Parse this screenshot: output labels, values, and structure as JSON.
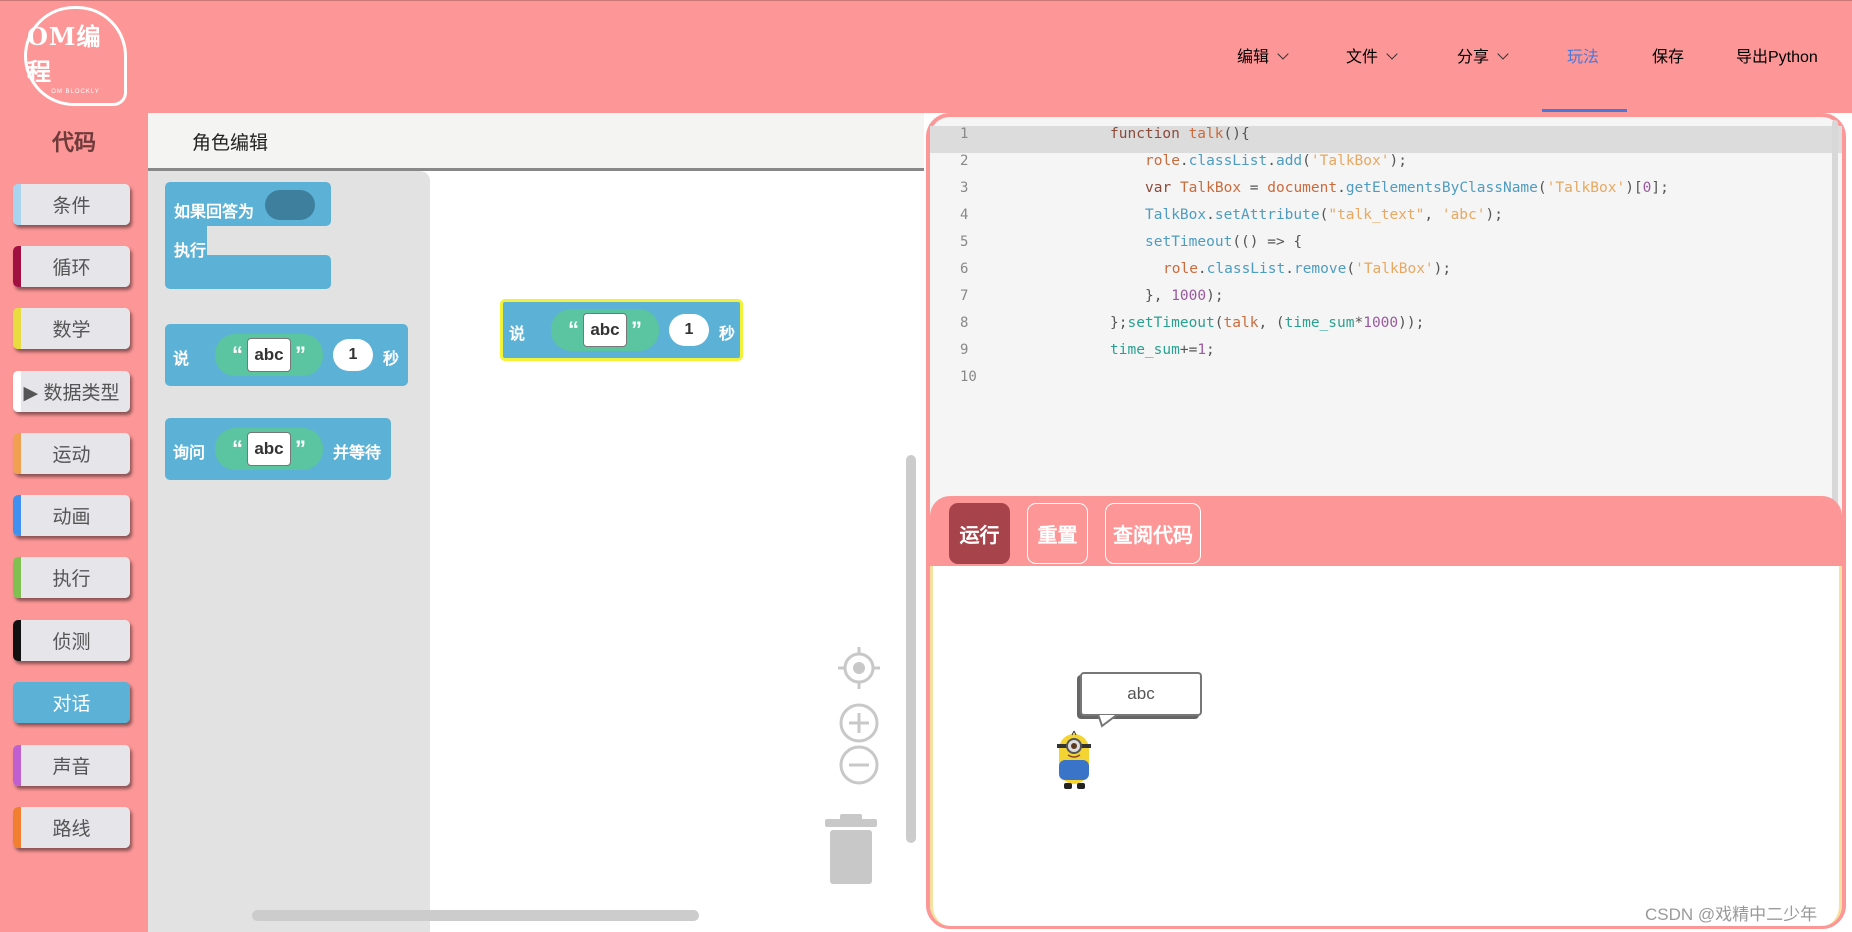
{
  "logo": {
    "main": "OM编程",
    "sub": "OM BLOCKLY"
  },
  "nav": {
    "edit": "编辑",
    "file": "文件",
    "share": "分享",
    "play": "玩法",
    "save": "保存",
    "export": "导出Python"
  },
  "tabs": {
    "code": "代码",
    "role_edit": "角色编辑"
  },
  "categories": [
    {
      "label": "条件",
      "color": "#a8d4f0"
    },
    {
      "label": "循环",
      "color": "#a01040"
    },
    {
      "label": "数学",
      "color": "#e8dc40"
    },
    {
      "label": "▶ 数据类型",
      "color": "#ffffff"
    },
    {
      "label": "运动",
      "color": "#f0a050"
    },
    {
      "label": "动画",
      "color": "#4090f0"
    },
    {
      "label": "执行",
      "color": "#80c050"
    },
    {
      "label": "侦测",
      "color": "#111111"
    },
    {
      "label": "对话",
      "color": "#5cb1d6"
    },
    {
      "label": "声音",
      "color": "#c060d0"
    },
    {
      "label": "路线",
      "color": "#f08030"
    }
  ],
  "blocks": {
    "if_answer": {
      "label": "如果回答为",
      "do_label": "执行"
    },
    "say": {
      "label": "说",
      "text": "abc",
      "secs": "1",
      "unit": "秒"
    },
    "ask": {
      "label": "询问",
      "text": "abc",
      "suffix": "并等待"
    },
    "ws_say": {
      "label": "说",
      "text": "abc",
      "secs": "1",
      "unit": "秒"
    },
    "quote_open": "“",
    "quote_close": "”"
  },
  "code": {
    "line_numbers": [
      "1",
      "2",
      "3",
      "4",
      "5",
      "6",
      "7",
      "8",
      "9",
      "10"
    ]
  },
  "buttons": {
    "run": "运行",
    "reset": "重置",
    "view_code": "查阅代码"
  },
  "stage": {
    "bubble_text": "abc"
  },
  "watermark": "CSDN @戏精中二少年",
  "colors": {
    "brand": "#fd9697",
    "block": "#5cb1d6",
    "string": "#5bc4a0",
    "accent": "#4a78d8",
    "run_button": "#a7434a"
  }
}
